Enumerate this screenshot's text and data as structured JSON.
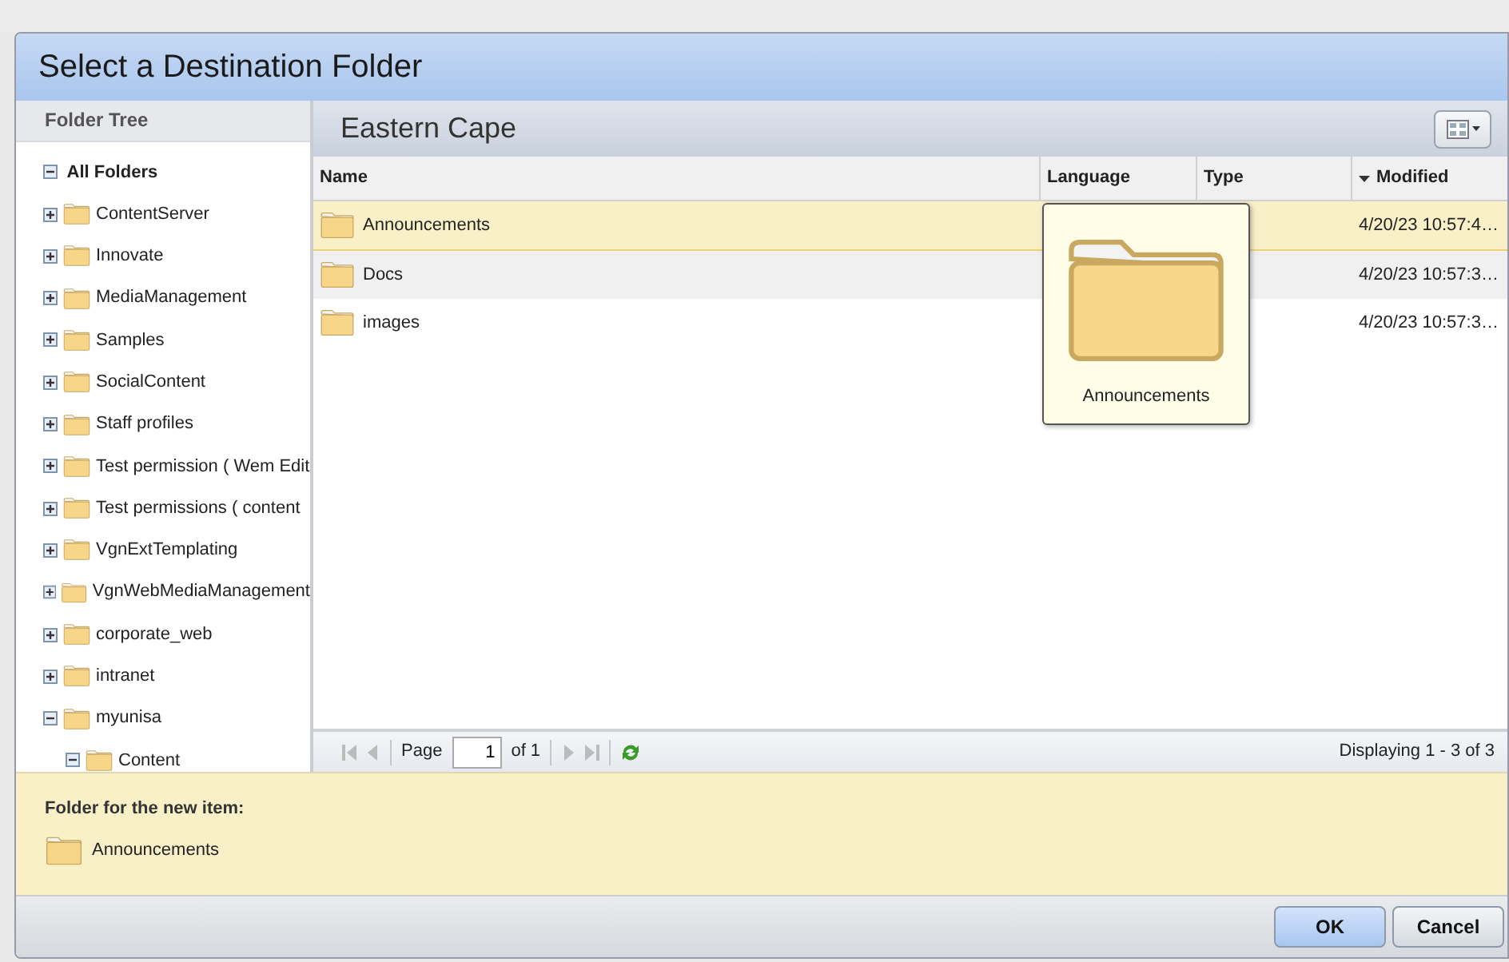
{
  "window": {
    "title": "Select a Destination Folder"
  },
  "folder_tree": {
    "title": "Folder Tree",
    "root": {
      "label": "All Folders",
      "expanded": true,
      "children": [
        {
          "label": "ContentServer",
          "expanded": false
        },
        {
          "label": "Innovate",
          "expanded": false
        },
        {
          "label": "MediaManagement",
          "expanded": false
        },
        {
          "label": "Samples",
          "expanded": false
        },
        {
          "label": "SocialContent",
          "expanded": false
        },
        {
          "label": "Staff profiles",
          "expanded": false
        },
        {
          "label": "Test permission ( Wem Edit",
          "expanded": false
        },
        {
          "label": "Test permissions ( content",
          "expanded": false
        },
        {
          "label": "VgnExtTemplating",
          "expanded": false
        },
        {
          "label": "VgnWebMediaManagement",
          "expanded": false
        },
        {
          "label": "corporate_web",
          "expanded": false
        },
        {
          "label": "intranet",
          "expanded": false
        },
        {
          "label": "myunisa",
          "expanded": true,
          "children": [
            {
              "label": "Content",
              "expanded": true
            }
          ]
        }
      ]
    }
  },
  "content": {
    "title": "Eastern Cape",
    "table": {
      "columns": [
        {
          "label": "Name",
          "sorted": false
        },
        {
          "label": "Language",
          "sorted": false
        },
        {
          "label": "Type",
          "sorted": false
        },
        {
          "label": "Modified",
          "sorted": true
        }
      ],
      "rows": [
        {
          "name": "Announcements",
          "modified": "4/20/23 10:57:4…",
          "selected": true
        },
        {
          "name": "Docs",
          "modified": "4/20/23 10:57:3…",
          "selected": false
        },
        {
          "name": "images",
          "modified": "4/20/23 10:57:3…",
          "selected": false
        }
      ]
    },
    "tooltip": {
      "label": "Announcements"
    },
    "paging": {
      "page_label": "Page",
      "page": "1",
      "of": "of 1",
      "display": "Displaying 1 - 3 of 3"
    }
  },
  "destination": {
    "label": "Folder for the new item:",
    "folder": "Announcements"
  },
  "buttons": [
    {
      "label": "OK",
      "primary": true
    },
    {
      "label": "Cancel",
      "primary": false
    }
  ]
}
